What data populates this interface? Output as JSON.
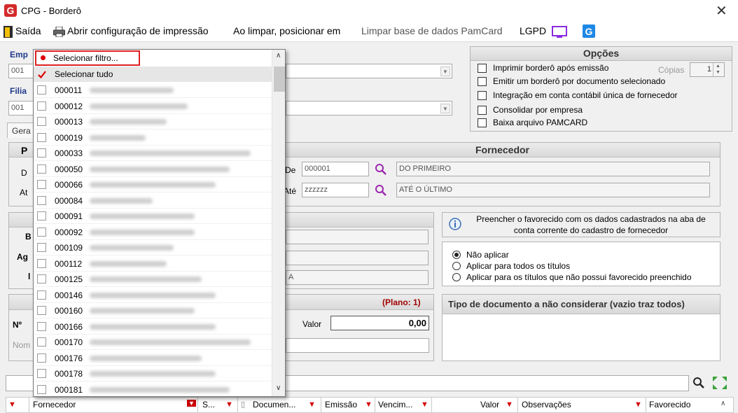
{
  "window": {
    "title": "CPG - Borderô",
    "close_glyph": "✕"
  },
  "toolbar": {
    "exit": "Saída",
    "print_config": "Abrir configuração de impressão",
    "on_clear": "Ao limpar, posicionar em",
    "clear_pamcard": "Limpar base de dados PamCard",
    "lgpd": "LGPD"
  },
  "form": {
    "empresa_label": "Emp",
    "empresa_value": "001",
    "filial_label": "Filia",
    "filial_value": "001",
    "tab_geral": "Gera",
    "periodo_head": "P",
    "de_label": "D",
    "ate_label": "At",
    "b_label": "B",
    "ag_label": "Ag",
    "l_label": "l",
    "n_label": "Nº",
    "nome_label": "Nom",
    "partial_a": "A"
  },
  "opcoes": {
    "title": "Opções",
    "copias_label": "Cópias",
    "copias_value": "1",
    "items": [
      "Imprimir borderô após emissão",
      "Emitir um borderô por documento selecionado",
      "Integração em conta contábil única de fornecedor",
      "Consolidar por empresa",
      "Baixa arquivo PAMCARD"
    ]
  },
  "fornecedor": {
    "title": "Fornecedor",
    "de_label": "De",
    "de_code": "000001",
    "de_name": "DO PRIMEIRO",
    "ate_label": "Até",
    "ate_code": "zzzzzz",
    "ate_name": "ATÉ O ÚLTIMO"
  },
  "favorecido": {
    "info": "Preencher o favorecido com os dados cadastrados na aba de conta corrente do cadastro de fornecedor",
    "options": [
      "Não aplicar",
      "Aplicar para todos os títulos",
      "Aplicar para os títulos que não possui favorecido preenchido"
    ],
    "selected": 0
  },
  "plano": {
    "label": "(Plano: 1)",
    "valor_label": "Valor",
    "valor_value": "0,00"
  },
  "tipo_doc": {
    "title": "Tipo de documento a não considerar (vazio traz todos)"
  },
  "dropdown": {
    "filter": "Selecionar filtro...",
    "select_all": "Selecionar tudo",
    "items": [
      "000011",
      "000012",
      "000013",
      "000019",
      "000033",
      "000050",
      "000066",
      "000084",
      "000091",
      "000092",
      "000109",
      "000112",
      "000125",
      "000146",
      "000160",
      "000166",
      "000170",
      "000176",
      "000178",
      "000181"
    ]
  },
  "grid": {
    "columns": [
      "Fornecedor",
      "S...",
      "Documen...",
      "Emissão",
      "Vencim...",
      "Valor",
      "Observações",
      "Favorecido"
    ]
  }
}
